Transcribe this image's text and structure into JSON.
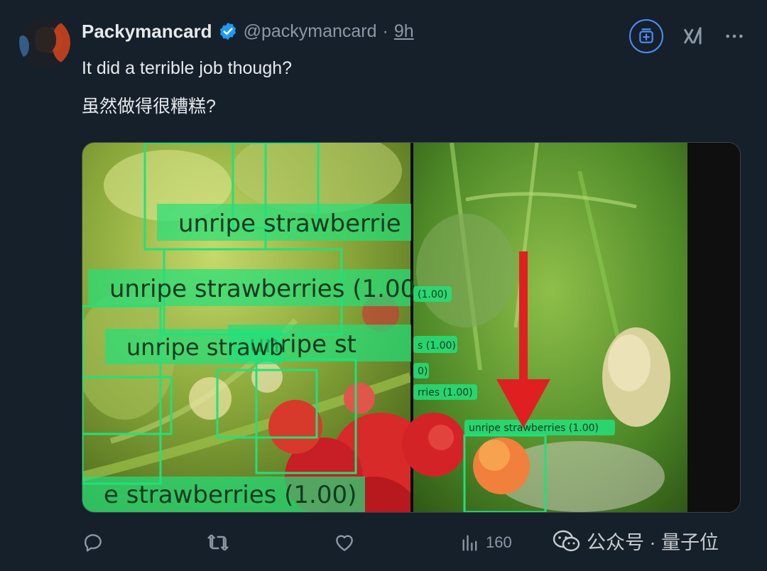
{
  "author": {
    "name": "Packymancard",
    "handle": "@packymancard",
    "separator": "·",
    "time": "9h"
  },
  "tweet": {
    "line1": "It did a terrible job though?",
    "line2": "虽然做得很糟糕?"
  },
  "media": {
    "left_labels": [
      "unripe strawberrie",
      "unripe strawberries (1.00",
      "unripe strawb",
      "unripe st",
      "e strawberries (1.00)"
    ],
    "right_labels": [
      "(1.00)",
      "s (1.00)",
      "0)",
      "rries (1.00)",
      "unripe strawberries (1.00)"
    ]
  },
  "actions": {
    "views": "160"
  },
  "watermark": {
    "text": "公众号 · 量子位"
  },
  "colors": {
    "background": "#15202b",
    "verified": "#1d9bf0",
    "grok_ring": "#4e8ef7",
    "detection_box": "#22e07a",
    "arrow": "#e02020"
  },
  "icons": [
    "verified-badge-icon",
    "grok-icon",
    "x-ai-icon",
    "more-icon",
    "reply-icon",
    "retweet-icon",
    "like-icon",
    "views-icon",
    "wechat-icon"
  ]
}
